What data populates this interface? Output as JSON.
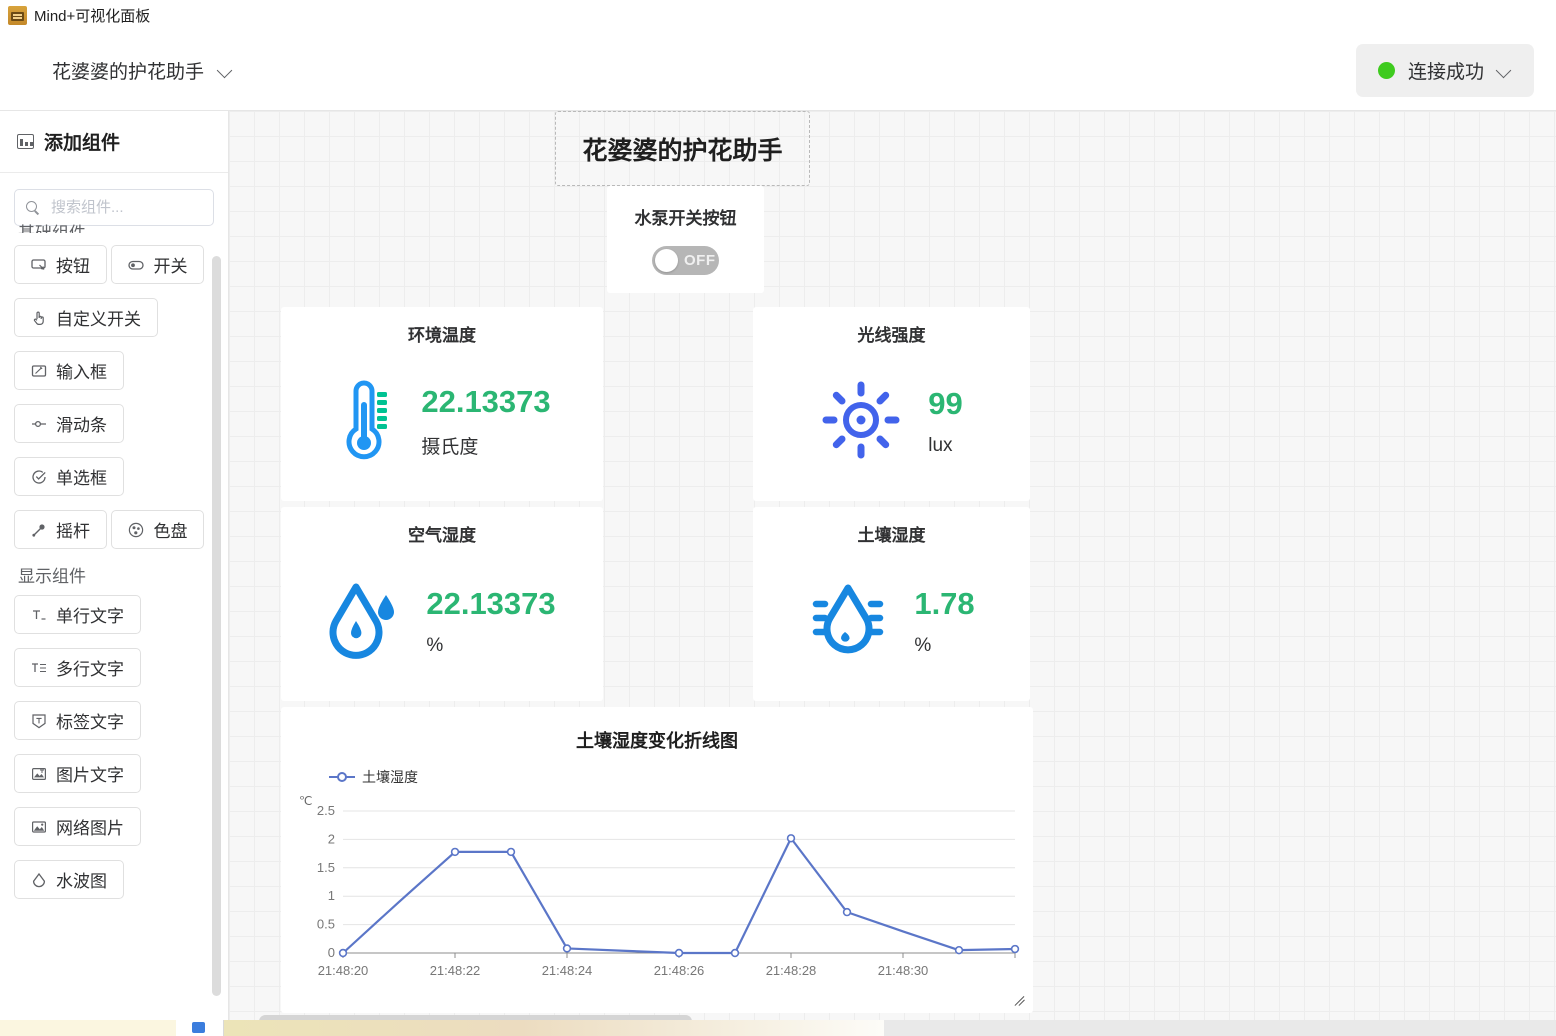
{
  "titlebar": {
    "app_title": "Mind+可视化面板",
    "app_icon": "robot-icon"
  },
  "header": {
    "project_name": "花婆婆的护花助手",
    "project_chevron_icon": "chevron-down-icon",
    "connection": {
      "label": "连接成功",
      "status_dot_icon": "status-dot-icon",
      "status_color": "#3ecb1e",
      "chevron_icon": "chevron-down-icon"
    }
  },
  "sidebar": {
    "header_title": "添加组件",
    "header_icon": "panel-icon",
    "search": {
      "placeholder": "搜索组件...",
      "value": "",
      "icon": "search-icon"
    },
    "groups": [
      {
        "title": "基础组件",
        "clipped": true,
        "items": [
          {
            "label": "按钮",
            "icon": "button-icon"
          },
          {
            "label": "开关",
            "icon": "switch-icon"
          },
          {
            "label": "自定义开关",
            "icon": "hand-tap-icon"
          },
          {
            "label": "输入框",
            "icon": "input-box-icon"
          },
          {
            "label": "滑动条",
            "icon": "slider-icon"
          },
          {
            "label": "单选框",
            "icon": "radio-check-icon"
          },
          {
            "label": "摇杆",
            "icon": "joystick-icon"
          },
          {
            "label": "色盘",
            "icon": "color-palette-icon"
          }
        ]
      },
      {
        "title": "显示组件",
        "clipped": false,
        "items": [
          {
            "label": "单行文字",
            "icon": "single-line-text-icon"
          },
          {
            "label": "多行文字",
            "icon": "multi-line-text-icon"
          },
          {
            "label": "标签文字",
            "icon": "tag-text-icon"
          },
          {
            "label": "图片文字",
            "icon": "image-text-icon"
          },
          {
            "label": "网络图片",
            "icon": "network-image-icon"
          },
          {
            "label": "水波图",
            "icon": "water-wave-icon"
          }
        ]
      }
    ]
  },
  "canvas": {
    "dashboard_title": "花婆婆的护花助手",
    "pump": {
      "label": "水泵开关按钮",
      "state_text": "OFF",
      "on": false
    },
    "cards": [
      {
        "id": "ambient-temperature",
        "title": "环境温度",
        "value": "22.13373",
        "unit": "摄氏度",
        "icon": "thermometer-icon",
        "icon_color": "#2196f3",
        "accent_color": "#00c292",
        "value_color": "#2bb673"
      },
      {
        "id": "light-intensity",
        "title": "光线强度",
        "value": "99",
        "unit": "lux",
        "icon": "sun-icon",
        "icon_color": "#4263eb",
        "value_color": "#2bb673"
      },
      {
        "id": "air-humidity",
        "title": "空气湿度",
        "value": "22.13373",
        "unit": "%",
        "icon": "water-drop-icon",
        "icon_color": "#1787e0",
        "value_color": "#2bb673"
      },
      {
        "id": "soil-moisture",
        "title": "土壤湿度",
        "value": "1.78",
        "unit": "%",
        "icon": "soil-moisture-drop-icon",
        "icon_color": "#1787e0",
        "value_color": "#2bb673"
      }
    ],
    "chart_widget": {
      "resize_handle_icon": "resize-handle-icon"
    }
  },
  "chart_data": {
    "type": "line",
    "title": "土壤湿度变化折线图",
    "legend": [
      "土壤湿度"
    ],
    "legend_position": "top-left",
    "line_color": "#5b76c8",
    "ylabel": "℃",
    "xlabel": "",
    "ylim": [
      0,
      2.5
    ],
    "yticks": [
      0,
      0.5,
      1,
      1.5,
      2,
      2.5
    ],
    "ytick_labels": [
      "0",
      "0.5",
      "1",
      "1.5",
      "2",
      "2.5"
    ],
    "xtick_labels": [
      "21:48:20",
      "21:48:22",
      "21:48:24",
      "21:48:26",
      "21:48:28",
      "21:48:30"
    ],
    "grid": true,
    "x": [
      "21:48:20",
      "21:48:21",
      "21:48:22",
      "21:48:23",
      "21:48:24",
      "21:48:25",
      "21:48:26",
      "21:48:27",
      "21:48:28",
      "21:48:29",
      "21:48:30",
      "21:48:31",
      "21:48:32"
    ],
    "series": [
      {
        "name": "土壤湿度",
        "values": [
          0,
          0.9,
          1.78,
          1.78,
          0.08,
          0.04,
          0,
          0,
          2.02,
          0.72,
          0.38,
          0.05,
          0.07
        ]
      }
    ],
    "markers": [
      {
        "x": "21:48:20",
        "y": 0
      },
      {
        "x": "21:48:22",
        "y": 1.78
      },
      {
        "x": "21:48:23",
        "y": 1.78
      },
      {
        "x": "21:48:24",
        "y": 0.08
      },
      {
        "x": "21:48:26",
        "y": 0
      },
      {
        "x": "21:48:27",
        "y": 0
      },
      {
        "x": "21:48:28",
        "y": 2.02
      },
      {
        "x": "21:48:29",
        "y": 0.72
      },
      {
        "x": "21:48:31",
        "y": 0.05
      },
      {
        "x": "21:48:32",
        "y": 0.07
      }
    ]
  }
}
